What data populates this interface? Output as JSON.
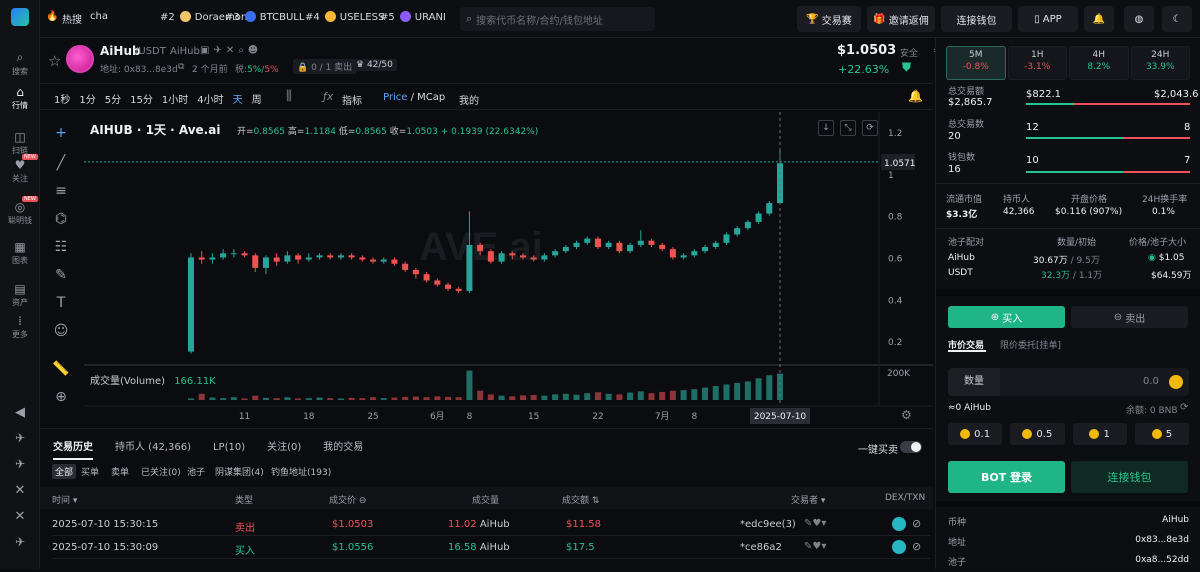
{
  "sidebar": {
    "items": [
      {
        "label": "搜索",
        "icon": "search-icon"
      },
      {
        "label": "行情",
        "icon": "home-icon"
      },
      {
        "label": "扫链",
        "icon": "scan-icon"
      },
      {
        "label": "关注",
        "icon": "heart-icon"
      },
      {
        "label": "聪明钱",
        "icon": "wallet-icon"
      },
      {
        "label": "图表",
        "icon": "chart-icon"
      },
      {
        "label": "资产",
        "icon": "assets-icon"
      },
      {
        "label": "更多",
        "icon": "more-icon"
      }
    ],
    "new_badge": "NEW"
  },
  "topbar": {
    "hot_label": "热搜",
    "hot_first": "cha",
    "trends": [
      {
        "rank": "#2",
        "name": "Doraemon"
      },
      {
        "rank": "#3",
        "name": "BTCBULL"
      },
      {
        "rank": "#4",
        "name": "USELESS"
      },
      {
        "rank": "#5",
        "name": "URANI"
      }
    ],
    "search_placeholder": "搜索代币名称/合约/钱包地址",
    "contest": "交易赛",
    "invite": "邀请返佣",
    "connect": "连接钱包",
    "app": "APP"
  },
  "token": {
    "symbol": "AiHub",
    "pair": "/USDT",
    "sub_name": "AiHub",
    "address_label": "地址: 0x83...8e3d",
    "age": "2 个月前",
    "tax_label": "税:",
    "tax_buy": "5%",
    "tax_sep": "/",
    "tax_sell": "5%",
    "sells": "0 / 1 卖出",
    "holders_ratio": "42/50",
    "price": "$1.0503",
    "change": "+22.63%",
    "safety": "安全"
  },
  "timeframes": {
    "stats": [
      {
        "period": "5M",
        "value": "-0.8%",
        "color": "red"
      },
      {
        "period": "1H",
        "value": "-3.1%",
        "color": "red"
      },
      {
        "period": "4H",
        "value": "8.2%",
        "color": "green"
      },
      {
        "period": "24H",
        "value": "33.9%",
        "color": "green"
      }
    ],
    "volume_label": "总交易额",
    "volume": "$2,865.7",
    "buy_vol": "$822.1",
    "sell_vol": "$2,043.6",
    "tx_label": "总交易数",
    "tx": "20",
    "tx_buy": "12",
    "tx_sell": "8",
    "wallet_label": "钱包数",
    "wallets": "16",
    "w_buy": "10",
    "w_sell": "7"
  },
  "market": {
    "headers": [
      "流通市值",
      "持币人",
      "开盘价格",
      "24H换手率"
    ],
    "values": [
      "$3.3亿",
      "42,366",
      "$0.116 (907%)",
      "0.1%"
    ]
  },
  "pool": {
    "headers": [
      "池子配对",
      "数量/初始",
      "价格/池子大小"
    ],
    "rows": [
      {
        "name": "AiHub",
        "amount": "30.67万",
        "initial": "/ 9.5万",
        "price": "$1.05"
      },
      {
        "name": "USDT",
        "amount": "32.3万",
        "initial": "/ 1.1万",
        "price": "$64.59万"
      }
    ]
  },
  "trade": {
    "buy": "买入",
    "sell": "卖出",
    "market_tab": "市价交易",
    "limit_tab": "限价委托[挂单]",
    "amount_label": "数量",
    "amount_value": "0.0",
    "receive": "≈0 AiHub",
    "balance": "余额: 0 BNB",
    "quick": [
      "0.1",
      "0.5",
      "1",
      "5"
    ],
    "bot": "BOT 登录",
    "connect": "连接钱包"
  },
  "info": {
    "rows": [
      {
        "k": "币种",
        "v": "AiHub"
      },
      {
        "k": "地址",
        "v": "0x83...8e3d"
      },
      {
        "k": "池子",
        "v": "0xa8...52dd"
      }
    ]
  },
  "chart_toolbar": {
    "intervals": [
      "1秒",
      "1分",
      "5分",
      "15分",
      "1小时",
      "4小时",
      "天",
      "周"
    ],
    "indicator": "指标",
    "price": "Price",
    "mcap": "MCap",
    "mine": "我的"
  },
  "chart_data": {
    "type": "candlestick",
    "title": "AIHUB · 1天 · Ave.ai",
    "ohlc_text": {
      "open_label": "开=",
      "open": "0.8565",
      "high_label": "高=",
      "high": "1.1184",
      "low_label": "低=",
      "low": "0.8565",
      "close_label": "收=",
      "close": "1.0503",
      "change": "+ 0.1939 (22.6342%)"
    },
    "watermark": "AVE.ai",
    "y_ticks": [
      "1.2",
      "1",
      "0.8",
      "0.6",
      "0.4",
      "0.2"
    ],
    "ylim": [
      0.1,
      1.2
    ],
    "last_price_label": "1.0571",
    "last_price": 1.0571,
    "x_ticks": [
      "11",
      "18",
      "25",
      "6月",
      "8",
      "15",
      "22",
      "7月",
      "8",
      "15"
    ],
    "x_ticks_pos": [
      5,
      11,
      17,
      23,
      26,
      32,
      38,
      44,
      47,
      54
    ],
    "crosshair_label": "2025-07-10",
    "volume_label": "成交量(Volume)",
    "volume_value": "166.11K",
    "volume_axis": "200K",
    "candles": [
      [
        0.15,
        0.6,
        0.62,
        0.14
      ],
      [
        0.6,
        0.59,
        0.63,
        0.57
      ],
      [
        0.59,
        0.6,
        0.62,
        0.57
      ],
      [
        0.6,
        0.62,
        0.64,
        0.59
      ],
      [
        0.62,
        0.62,
        0.64,
        0.6
      ],
      [
        0.62,
        0.61,
        0.63,
        0.6
      ],
      [
        0.61,
        0.55,
        0.62,
        0.53
      ],
      [
        0.55,
        0.6,
        0.61,
        0.52
      ],
      [
        0.6,
        0.58,
        0.62,
        0.56
      ],
      [
        0.58,
        0.61,
        0.63,
        0.57
      ],
      [
        0.61,
        0.59,
        0.62,
        0.57
      ],
      [
        0.59,
        0.6,
        0.62,
        0.58
      ],
      [
        0.6,
        0.61,
        0.62,
        0.59
      ],
      [
        0.61,
        0.6,
        0.62,
        0.59
      ],
      [
        0.6,
        0.61,
        0.62,
        0.59
      ],
      [
        0.61,
        0.6,
        0.62,
        0.59
      ],
      [
        0.6,
        0.59,
        0.61,
        0.58
      ],
      [
        0.59,
        0.58,
        0.6,
        0.57
      ],
      [
        0.58,
        0.59,
        0.6,
        0.57
      ],
      [
        0.59,
        0.57,
        0.6,
        0.56
      ],
      [
        0.57,
        0.54,
        0.58,
        0.53
      ],
      [
        0.54,
        0.52,
        0.55,
        0.5
      ],
      [
        0.52,
        0.49,
        0.53,
        0.48
      ],
      [
        0.49,
        0.47,
        0.5,
        0.46
      ],
      [
        0.47,
        0.45,
        0.48,
        0.44
      ],
      [
        0.45,
        0.44,
        0.46,
        0.43
      ],
      [
        0.44,
        0.66,
        0.82,
        0.43
      ],
      [
        0.66,
        0.63,
        0.67,
        0.61
      ],
      [
        0.63,
        0.58,
        0.64,
        0.57
      ],
      [
        0.58,
        0.62,
        0.63,
        0.57
      ],
      [
        0.62,
        0.61,
        0.63,
        0.59
      ],
      [
        0.61,
        0.6,
        0.62,
        0.59
      ],
      [
        0.6,
        0.59,
        0.61,
        0.58
      ],
      [
        0.59,
        0.61,
        0.62,
        0.58
      ],
      [
        0.61,
        0.63,
        0.64,
        0.6
      ],
      [
        0.63,
        0.65,
        0.66,
        0.62
      ],
      [
        0.65,
        0.67,
        0.68,
        0.64
      ],
      [
        0.67,
        0.69,
        0.7,
        0.66
      ],
      [
        0.69,
        0.65,
        0.7,
        0.64
      ],
      [
        0.65,
        0.67,
        0.68,
        0.64
      ],
      [
        0.67,
        0.63,
        0.68,
        0.62
      ],
      [
        0.63,
        0.66,
        0.67,
        0.62
      ],
      [
        0.66,
        0.68,
        0.73,
        0.65
      ],
      [
        0.68,
        0.66,
        0.69,
        0.65
      ],
      [
        0.66,
        0.64,
        0.67,
        0.63
      ],
      [
        0.64,
        0.6,
        0.65,
        0.59
      ],
      [
        0.6,
        0.61,
        0.62,
        0.59
      ],
      [
        0.61,
        0.63,
        0.64,
        0.6
      ],
      [
        0.63,
        0.65,
        0.66,
        0.62
      ],
      [
        0.65,
        0.67,
        0.68,
        0.64
      ],
      [
        0.67,
        0.71,
        0.72,
        0.66
      ],
      [
        0.71,
        0.74,
        0.75,
        0.7
      ],
      [
        0.74,
        0.77,
        0.78,
        0.73
      ],
      [
        0.77,
        0.81,
        0.82,
        0.76
      ],
      [
        0.81,
        0.86,
        0.87,
        0.8
      ],
      [
        0.86,
        1.0503,
        1.1184,
        0.8565
      ]
    ],
    "volumes": [
      5,
      20,
      8,
      6,
      9,
      5,
      14,
      7,
      6,
      9,
      5,
      6,
      8,
      6,
      5,
      7,
      6,
      9,
      6,
      8,
      10,
      11,
      9,
      12,
      10,
      9,
      95,
      30,
      18,
      14,
      12,
      15,
      16,
      14,
      18,
      20,
      17,
      22,
      25,
      20,
      18,
      24,
      28,
      22,
      26,
      30,
      32,
      35,
      40,
      45,
      50,
      55,
      60,
      70,
      80,
      85
    ]
  },
  "bottom": {
    "tabs": [
      "交易历史",
      "持币人 (42,366)",
      "LP(10)",
      "关注(0)",
      "我的交易"
    ],
    "quick_buy": "一键买卖",
    "filters": [
      "全部",
      "买单",
      "卖单",
      "已关注(0)",
      "池子",
      "阴谋集团(4)",
      "钓鱼地址(193)"
    ],
    "columns": [
      "时间",
      "类型",
      "成交价",
      "成交量",
      "成交额",
      "交易者",
      "DEX/TXN"
    ],
    "rows": [
      {
        "time": "2025-07-10 15:30:15",
        "type": "卖出",
        "type_color": "red",
        "price": "$1.0503",
        "qty": "11.02",
        "qty_unit": "AiHub",
        "amount": "$11.58",
        "trader": "*edc9ee(3)"
      },
      {
        "time": "2025-07-10 15:30:09",
        "type": "买入",
        "type_color": "green",
        "price": "$1.0556",
        "qty": "16.58",
        "qty_unit": "AiHub",
        "amount": "$17.5",
        "trader": "*ce86a2"
      }
    ]
  }
}
